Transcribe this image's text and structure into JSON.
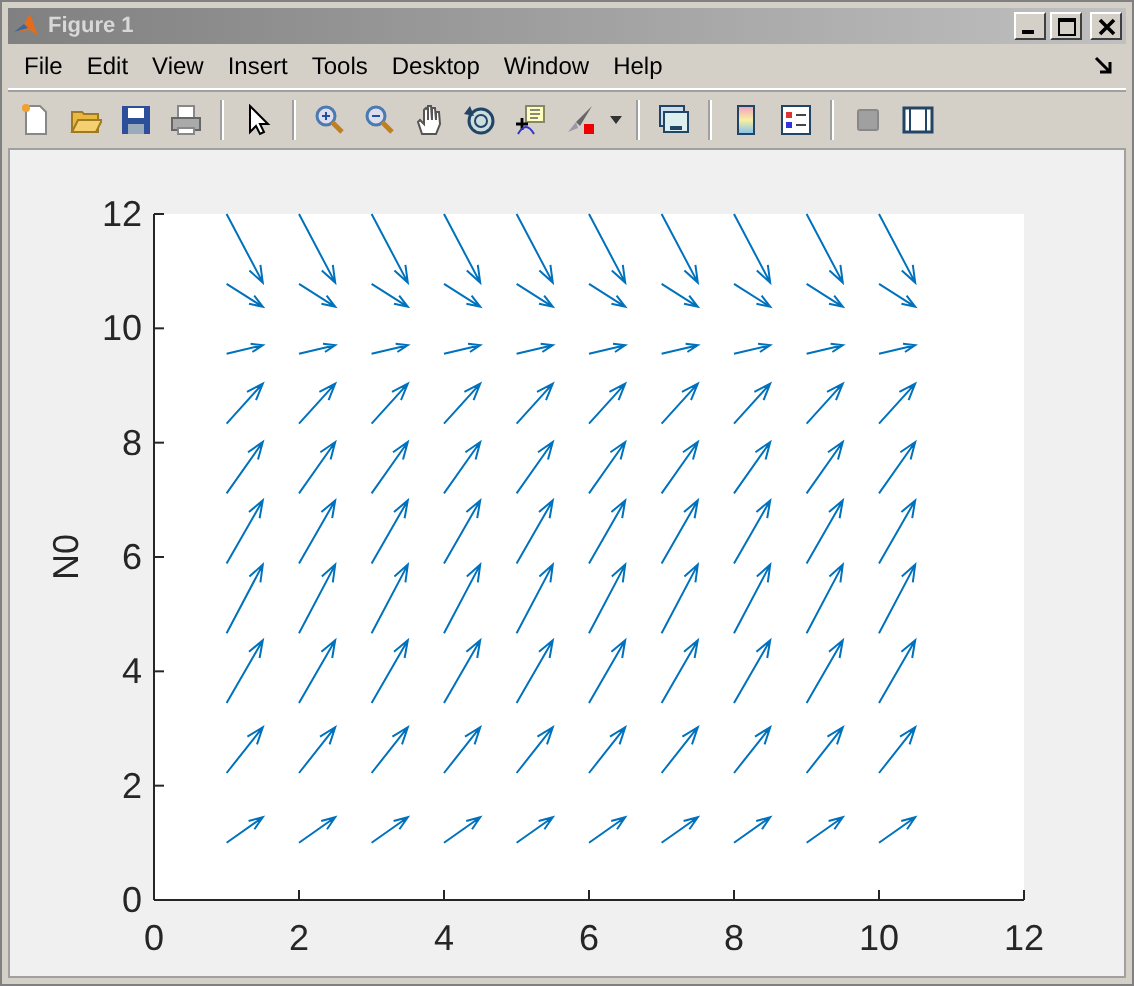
{
  "window": {
    "title": "Figure 1"
  },
  "menu": [
    "File",
    "Edit",
    "View",
    "Insert",
    "Tools",
    "Desktop",
    "Window",
    "Help"
  ],
  "plot": {
    "ylabel": "N0",
    "xticks": [
      "0",
      "2",
      "4",
      "6",
      "8",
      "10",
      "12"
    ],
    "yticks": [
      "12",
      "10",
      "8",
      "6",
      "4",
      "2",
      "0"
    ]
  }
}
